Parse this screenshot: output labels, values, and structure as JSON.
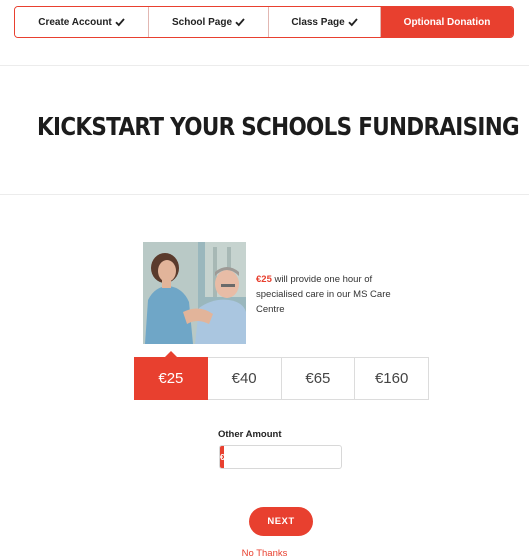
{
  "stepper": {
    "steps": [
      {
        "label": "Create Account",
        "status": "complete",
        "icon": "check-icon"
      },
      {
        "label": "School Page",
        "status": "complete",
        "icon": "check-icon"
      },
      {
        "label": "Class Page",
        "status": "complete",
        "icon": "check-icon"
      },
      {
        "label": "Optional Donation",
        "status": "active"
      }
    ]
  },
  "heading": "KICKSTART YOUR SCHOOLS FUNDRAISING",
  "impact": {
    "amount": "€25",
    "text": " will provide one hour of specialised care in our MS Care Centre"
  },
  "amounts": [
    {
      "label": "€25",
      "selected": true
    },
    {
      "label": "€40",
      "selected": false
    },
    {
      "label": "€65",
      "selected": false
    },
    {
      "label": "€160",
      "selected": false
    }
  ],
  "other_amount": {
    "label": "Other Amount",
    "currency": "€",
    "value": ""
  },
  "next_label": "NEXT",
  "no_thanks_label": "No Thanks",
  "colors": {
    "accent": "#e8402f"
  }
}
